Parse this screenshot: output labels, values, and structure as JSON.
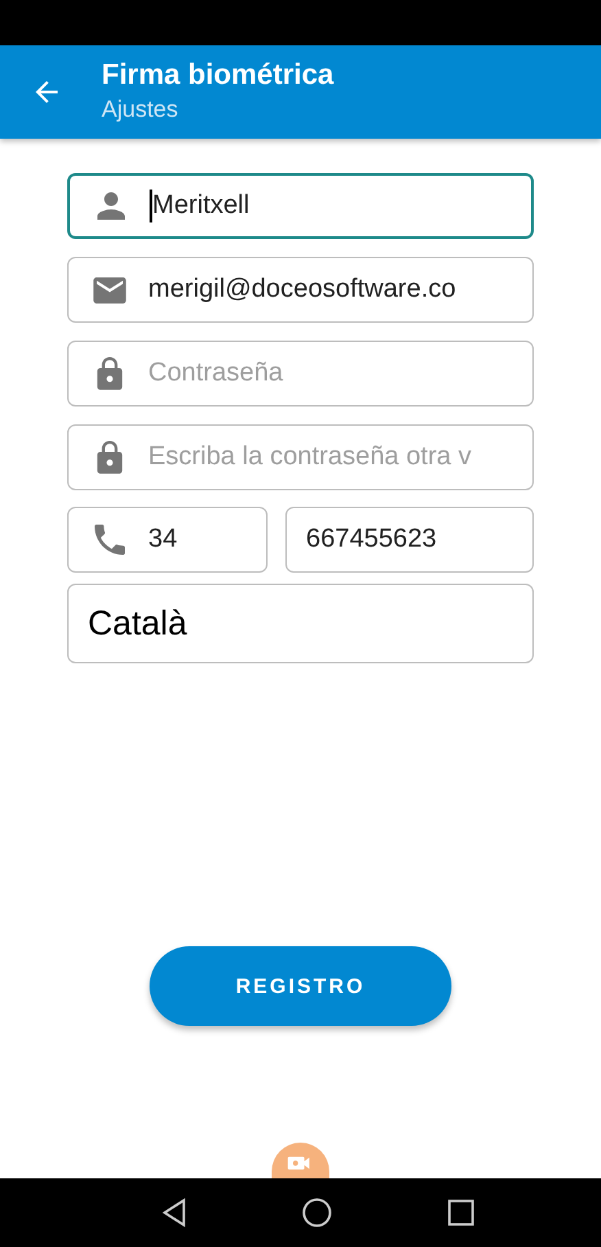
{
  "app_bar": {
    "title": "Firma biométrica",
    "subtitle": "Ajustes"
  },
  "fields": [
    {
      "kind": "name",
      "value": "Meritxell",
      "focused": true
    },
    {
      "kind": "email",
      "value": "merigil@doceosoftware.co",
      "focused": false
    },
    {
      "kind": "password",
      "placeholder": "Contraseña",
      "focused": false
    },
    {
      "kind": "password",
      "placeholder": "Escriba la contraseña otra v",
      "focused": false
    }
  ],
  "phone": {
    "prefix": "34",
    "number": "667455623"
  },
  "language": {
    "value": "Català"
  },
  "register_button": {
    "label": "REGISTRO"
  }
}
